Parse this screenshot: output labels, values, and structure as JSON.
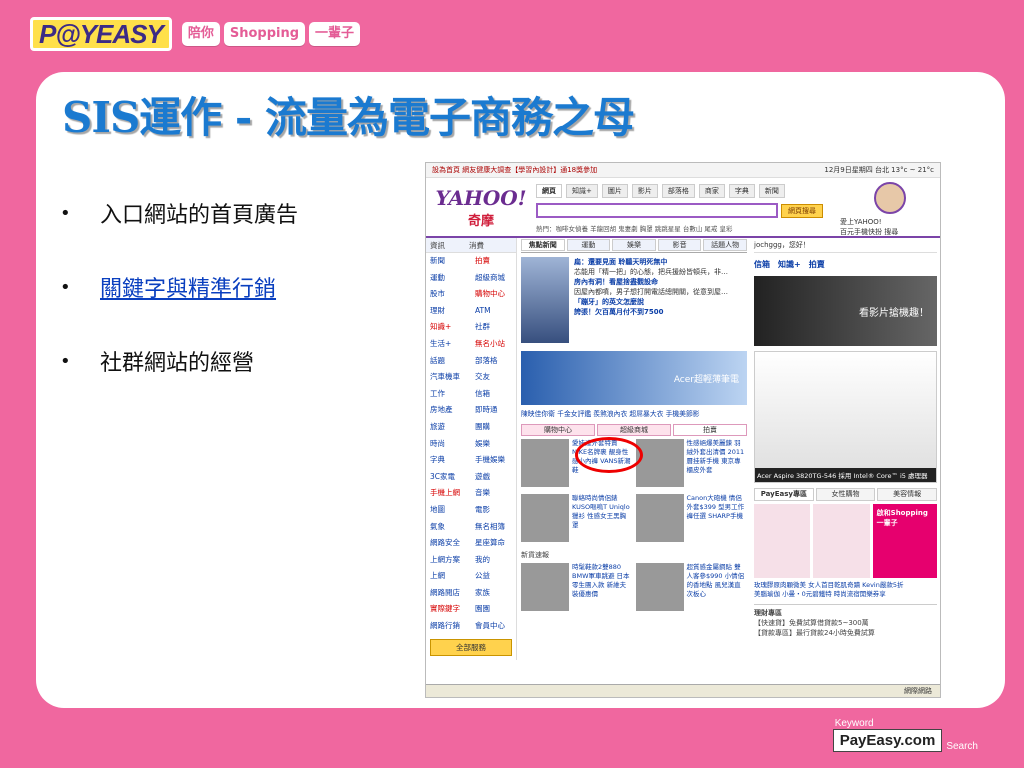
{
  "header": {
    "logo": "P@YEASY",
    "tagline": [
      "陪你",
      "Shopping",
      "一輩子"
    ]
  },
  "slide": {
    "title": "SIS運作 - 流量為電子商務之母",
    "bullets": [
      {
        "text": "入口網站的首頁廣告",
        "link": false
      },
      {
        "text": "關鍵字與精準行銷",
        "link": true
      },
      {
        "text": "社群網站的經營",
        "link": false
      }
    ]
  },
  "footer": {
    "keyword": "Keyword",
    "brand": "PayEasy.com",
    "search": "Search"
  },
  "yahoo": {
    "topbar_left": "設為首頁 網友健康大調查【學習內設計】通18獎參加",
    "topbar_right": "12月9日星期四   台北 13°c ~ 21°c",
    "logo_en": "YAHOO!",
    "logo_zh": "奇摩",
    "tabs": [
      "網頁",
      "知識+",
      "圖片",
      "影片",
      "部落格",
      "商家",
      "字典",
      "新聞"
    ],
    "search_button": "網頁搜尋",
    "hot": "熱門：咖啡女偵養  羊龍回胡  鬼妻劇  胸罩  跳跳星星  台數山  尾戒  皇彩",
    "right_user": "愛上YAHOO!",
    "right_links": "百元手機快扮  搜尋",
    "leftnav_headers": [
      "資訊",
      "消費"
    ],
    "leftnav_col1": [
      "新聞",
      "運動",
      "股市",
      "理財",
      "知識+",
      "生活+",
      "話題",
      "汽車機車",
      "工作",
      "房地產",
      "旅遊",
      "時尚",
      "字典",
      "3C家電",
      "手機上網",
      "地圖",
      "氣象",
      "網路安全",
      "上網方案",
      "上網",
      "網路閱店",
      "實際鍵字",
      "網路行銷"
    ],
    "leftnav_col2": [
      "拍賣",
      "超級商城",
      "購物中心",
      "ATM",
      "社群",
      "無名小站",
      "部落格",
      "交友",
      "信箱",
      "即時通",
      "團購",
      "娛樂",
      "手機娛樂",
      "遊戲",
      "音樂",
      "電影",
      "無名相簿",
      "星座算命",
      "我的",
      "公益",
      "家族",
      "園園",
      "會員中心"
    ],
    "all_services": "全部服務",
    "news_tabs": [
      "焦點新聞",
      "運動",
      "娛樂",
      "影音",
      "話題人物"
    ],
    "news": [
      {
        "t": "扁：還要見面 聆聽天明死無中",
        "hl": true
      },
      {
        "t": "芯能用「精一把」的心態，把兵援紛皆頓兵，非…",
        "hl": false
      },
      {
        "t": "房內有洞！看屋捨盡觀設命",
        "hl": true
      },
      {
        "t": "因屋內都噴，男子想打開電話總開關，從意到屋…",
        "hl": false
      },
      {
        "t": "「蹦牙」的英文怎麼說",
        "hl": true
      },
      {
        "t": "誇張！欠百萬月付不到7500",
        "hl": true
      }
    ],
    "banner": "Acer超輕薄筆電",
    "banner_links": "陳映佳你衛  千金女評鑑  羨煞浪內衣  超屌暴大衣  手機美節影",
    "shop_tabs": [
      "購物中心",
      "超級商城",
      "拍賣"
    ],
    "products": [
      "愛娃達外套特賣 NIKE名牌裹 靚身性感小內褲 VANS新潮鞋",
      "性感絕爆美麗鍊 羽絨外套出清價 2011曆挂新手機 東京專櫃皮外套",
      "聯絡時尚情侶錶 KUSO嘔嗚T Uniqlo獵衫 性感女王黑胸罩",
      "Canon大砲機 情侶外套$399 型男工作褲任選 SHARP手機"
    ],
    "new_items": "新貨速報",
    "products2": [
      "時髦鞋款2雙880 BMW軍車跳避 日本零生團入款 新維夫裝優惠價",
      "超質感金屬鋼貼 雙人客參$990 小情侶的香地點 風兒漢直次板心"
    ],
    "user": "jochggg，您好！",
    "quick": [
      "信箱",
      "知識+",
      "拍賣"
    ],
    "ad1": "看影片搶機趣！",
    "laptop_caption": "Acer Aspire 3820TG-546 採用 Intel® Core™ i5 處理器",
    "payeasy_tabs": [
      "PayEasy專區",
      "女性購物",
      "美容情報"
    ],
    "payeasy_cta": "啟和Shopping 一輩子",
    "payeasy_texts": [
      "玫瑰膠原肉顆微美 女人首目乾肌奇蹟 Kevin嚴款5折",
      "美腦瑜伽 小曼・0元碧鐵特 時尚流宿開樂券享"
    ],
    "finance": [
      "理財專區",
      "【快速貸】免費試算借貸款5~300萬",
      "【貸款專區】最行貸款24小時免費試算"
    ],
    "status": "網際網路"
  }
}
